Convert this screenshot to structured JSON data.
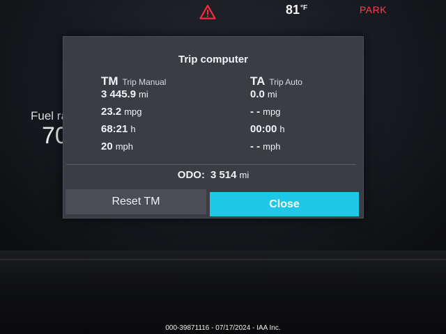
{
  "status": {
    "warning_icon": "warning-triangle-icon",
    "warning_color": "#ff2a3d",
    "temperature": "81",
    "temperature_unit": "°F",
    "gear": "PARK"
  },
  "background": {
    "label": "Fuel ra",
    "value": "70"
  },
  "dialog": {
    "title": "Trip computer",
    "trip_manual": {
      "code": "TM",
      "name": "Trip Manual",
      "rows": [
        {
          "value": "3 445.9",
          "unit": "mi"
        },
        {
          "value": "23.2",
          "unit": "mpg"
        },
        {
          "value": "68:21",
          "unit": "h"
        },
        {
          "value": "20",
          "unit": "mph"
        }
      ]
    },
    "trip_auto": {
      "code": "TA",
      "name": "Trip Auto",
      "rows": [
        {
          "value": "0.0",
          "unit": "mi"
        },
        {
          "value": "- -",
          "unit": "mpg"
        },
        {
          "value": "00:00",
          "unit": "h"
        },
        {
          "value": "- -",
          "unit": "mph"
        }
      ]
    },
    "odo": {
      "label": "ODO:",
      "value": "3 514",
      "unit": "mi"
    },
    "reset_label": "Reset TM",
    "close_label": "Close",
    "accent_color": "#1ec8e6"
  },
  "footer": {
    "watermark": "000-39871116 - 07/17/2024 - IAA Inc."
  }
}
